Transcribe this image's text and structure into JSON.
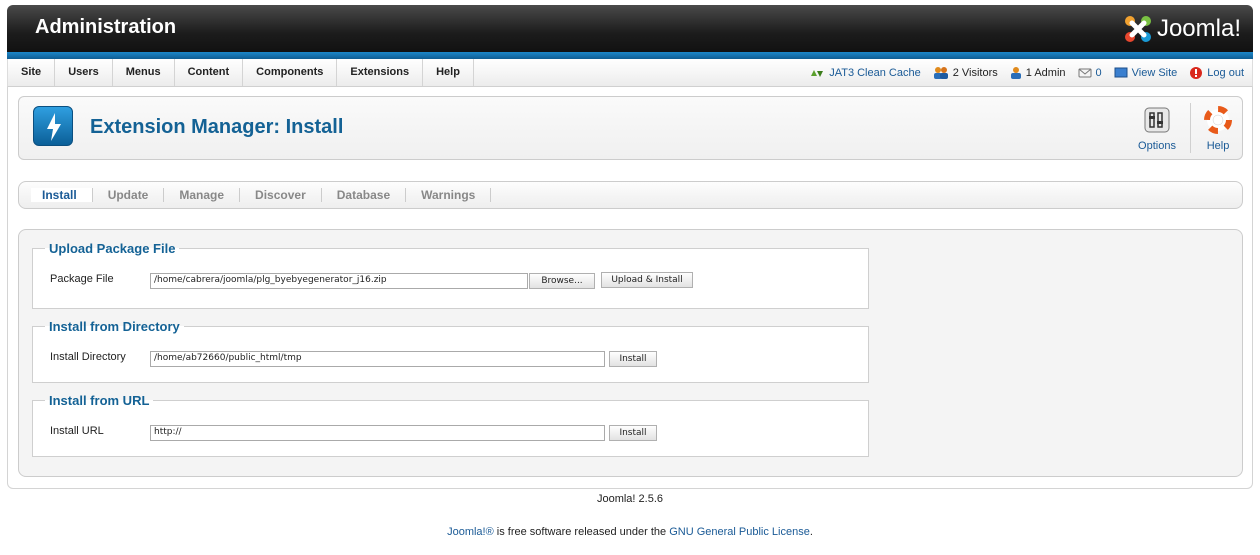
{
  "header": {
    "title": "Administration",
    "logo_text": "Joomla!"
  },
  "menu": {
    "items": [
      "Site",
      "Users",
      "Menus",
      "Content",
      "Components",
      "Extensions",
      "Help"
    ]
  },
  "status": {
    "cache": "JAT3 Clean Cache",
    "visitors": "2 Visitors",
    "admins": "1 Admin",
    "messages": "0",
    "view_site": "View Site",
    "logout": "Log out"
  },
  "toolbar": {
    "title": "Extension Manager: Install",
    "options_label": "Options",
    "help_label": "Help"
  },
  "submenu": {
    "tabs": [
      "Install",
      "Update",
      "Manage",
      "Discover",
      "Database",
      "Warnings"
    ]
  },
  "upload": {
    "legend": "Upload Package File",
    "label": "Package File",
    "value": "/home/cabrera/joomla/plg_byebyegenerator_j16.zip",
    "browse": "Browse...",
    "submit": "Upload & Install"
  },
  "directory": {
    "legend": "Install from Directory",
    "label": "Install Directory",
    "value": "/home/ab72660/public_html/tmp",
    "submit": "Install"
  },
  "url": {
    "legend": "Install from URL",
    "label": "Install URL",
    "value": "http://",
    "submit": "Install"
  },
  "footer": {
    "version": "Joomla! 2.5.6",
    "license_link1": "Joomla!®",
    "license_text": " is free software released under the ",
    "license_link2": "GNU General Public License",
    "license_end": "."
  },
  "colors": {
    "accent": "#146295",
    "stripe": "#1c87c9",
    "header_bg": "#1c1c1c"
  }
}
